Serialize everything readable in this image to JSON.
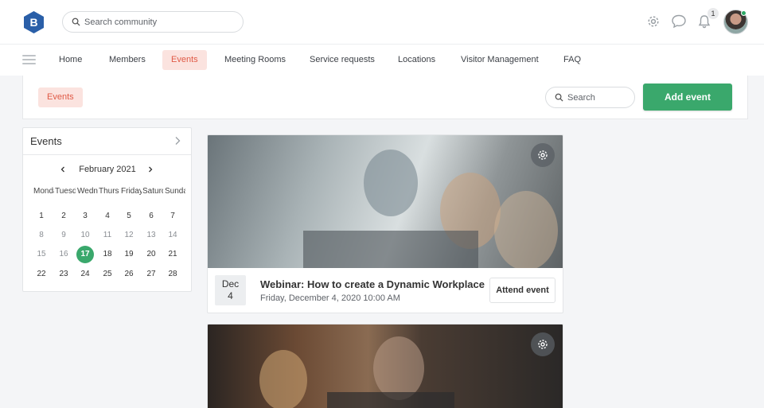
{
  "colors": {
    "accent_green": "#3aa86c",
    "active_nav_bg": "#fbe3df",
    "active_nav_text": "#e05a46",
    "brand_blue": "#2a5fa8"
  },
  "header": {
    "logo_icon": "b-logo-icon",
    "search_placeholder": "Search community",
    "notification_count": "1",
    "icons": [
      "gear-icon",
      "chat-bubble-icon",
      "bell-icon"
    ]
  },
  "nav": {
    "items": [
      "Home",
      "Members",
      "Events",
      "Meeting Rooms",
      "Service requests",
      "Locations",
      "Visitor Management",
      "FAQ"
    ],
    "active": "Events"
  },
  "page": {
    "tab_label": "Events",
    "search_placeholder": "Search",
    "add_button": "Add event"
  },
  "calendar": {
    "title": "Events",
    "month_label": "February 2021",
    "weekdays": [
      "Monday",
      "Tuesday",
      "Wednesday",
      "Thursday",
      "Friday",
      "Saturday",
      "Sunday"
    ],
    "weeks": [
      [
        "1",
        "2",
        "3",
        "4",
        "5",
        "6",
        "7"
      ],
      [
        "8",
        "9",
        "10",
        "11",
        "12",
        "13",
        "14"
      ],
      [
        "15",
        "16",
        "17",
        "18",
        "19",
        "20",
        "21"
      ],
      [
        "22",
        "23",
        "24",
        "25",
        "26",
        "27",
        "28"
      ]
    ],
    "today": "17"
  },
  "events": [
    {
      "month": "Dec",
      "day": "4",
      "title": "Webinar: How to create a Dynamic Workplace",
      "datetime": "Friday, December 4, 2020 10:00 AM",
      "attend_label": "Attend event"
    }
  ]
}
